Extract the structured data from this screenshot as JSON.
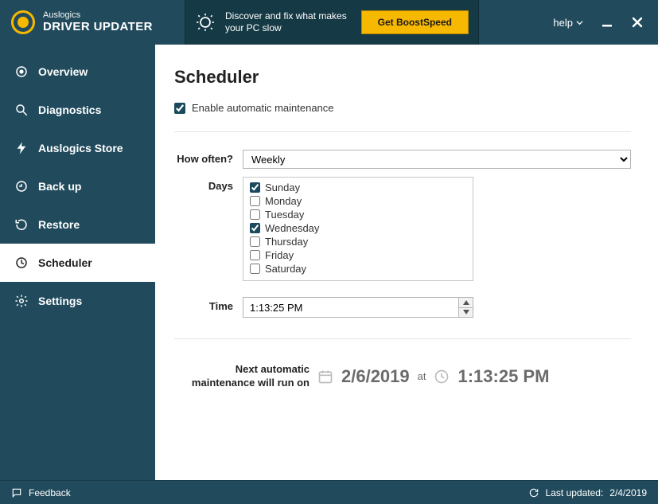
{
  "titlebar": {
    "brand_line1": "Auslogics",
    "brand_line2": "DRIVER UPDATER",
    "promo_line1": "Discover and fix what makes",
    "promo_line2": "your PC slow",
    "promo_button": "Get BoostSpeed",
    "help_label": "help"
  },
  "sidebar": {
    "items": [
      {
        "label": "Overview"
      },
      {
        "label": "Diagnostics"
      },
      {
        "label": "Auslogics Store"
      },
      {
        "label": "Back up"
      },
      {
        "label": "Restore"
      },
      {
        "label": "Scheduler"
      },
      {
        "label": "Settings"
      }
    ],
    "active_index": 5
  },
  "page": {
    "title": "Scheduler",
    "enable_label": "Enable automatic maintenance",
    "enable_checked": true,
    "how_often_label": "How often?",
    "frequency_selected": "Weekly",
    "frequency_options": [
      "Weekly"
    ],
    "days_label": "Days",
    "days": [
      {
        "name": "Sunday",
        "checked": true
      },
      {
        "name": "Monday",
        "checked": false
      },
      {
        "name": "Tuesday",
        "checked": false
      },
      {
        "name": "Wednesday",
        "checked": true
      },
      {
        "name": "Thursday",
        "checked": false
      },
      {
        "name": "Friday",
        "checked": false
      },
      {
        "name": "Saturday",
        "checked": false
      }
    ],
    "time_label": "Time",
    "time_value": "1:13:25 PM",
    "next_run_label_l1": "Next automatic",
    "next_run_label_l2": "maintenance will run on",
    "next_run_date": "2/6/2019",
    "next_run_at": "at",
    "next_run_time": "1:13:25 PM"
  },
  "footer": {
    "feedback": "Feedback",
    "last_updated_label": "Last updated:",
    "last_updated_value": "2/4/2019"
  }
}
